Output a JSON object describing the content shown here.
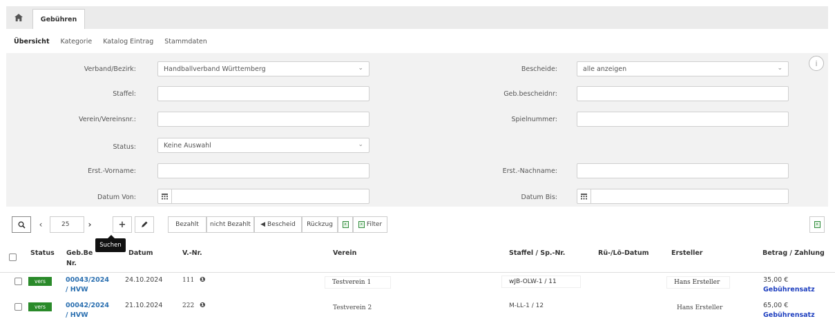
{
  "topbar": {
    "home_icon": "home-icon",
    "tab_label": "Gebühren"
  },
  "subnav": {
    "items": [
      "Übersicht",
      "Kategorie",
      "Katalog Eintrag",
      "Stammdaten"
    ]
  },
  "filters": {
    "verband_label": "Verband/Bezirk:",
    "verband_value": "Handballverband Württemberg",
    "staffel_label": "Staffel:",
    "verein_label": "Verein/Vereinsnr.:",
    "status_label": "Status:",
    "status_value": "Keine Auswahl",
    "vorname_label": "Erst.-Vorname:",
    "datum_von_label": "Datum Von:",
    "bescheide_label": "Bescheide:",
    "bescheide_value": "alle anzeigen",
    "gebbescheid_label": "Geb.bescheidnr:",
    "spielnummer_label": "Spielnummer:",
    "nachname_label": "Erst.-Nachname:",
    "datum_bis_label": "Datum Bis:"
  },
  "toolbar": {
    "page_size": "25",
    "bezahlt": "Bezahlt",
    "nicht_bezahlt": "nicht Bezahlt",
    "bescheid": "Bescheid",
    "rueckzug": "Rückzug",
    "filter": "Filter",
    "tooltip": "Suchen"
  },
  "table": {
    "headers": {
      "status": "Status",
      "gebnr": "Geb.Be",
      "gebnr2": "Nr.",
      "datum": "Datum",
      "vnr": "V.-Nr.",
      "verein": "Verein",
      "staffel": "Staffel / Sp.-Nr.",
      "ruelo": "Rü-/Lö-Datum",
      "ersteller": "Ersteller",
      "betrag": "Betrag / Zahlung"
    },
    "rows": [
      {
        "status": "vers",
        "nr": "00043/2024",
        "nr2": "/ HVW",
        "datum": "24.10.2024",
        "vnr": "111",
        "verein": "Testverein 1",
        "staffel": "wJB-OLW-1 /  11",
        "ersteller": "Hans Ersteller",
        "betrag": "35,00 €",
        "zahlung": "Gebührensatz"
      },
      {
        "status": "vers",
        "nr": "00042/2024",
        "nr2": "/ HVW",
        "datum": "21.10.2024",
        "vnr": "222",
        "verein": "Testverein 2",
        "staffel": "M-LL-1 /  12",
        "ersteller": "Hans Ersteller",
        "betrag": "65,00 €",
        "zahlung": "Gebührensatz"
      }
    ]
  },
  "colors": {
    "badge": "#2a8a2a",
    "link": "#2a6fb0",
    "excel": "#2e8b3a"
  }
}
